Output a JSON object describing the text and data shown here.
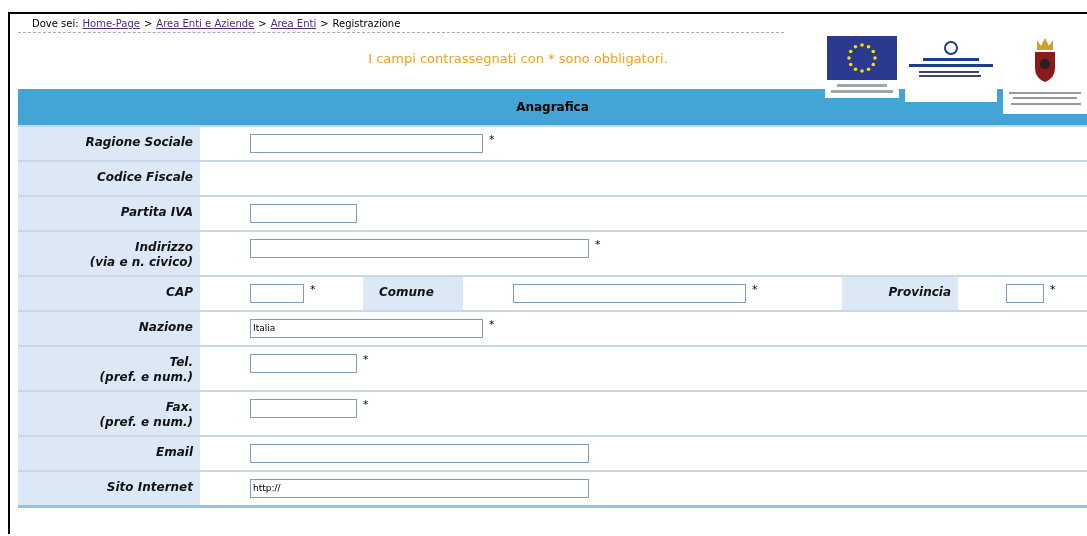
{
  "breadcrumb": {
    "label": "Dove sei:",
    "links": [
      "Home-Page",
      "Area Enti e Aziende",
      "Area Enti"
    ],
    "current": "Registrazione",
    "separator": ">"
  },
  "notice": "I campi contrassegnati con * sono obbligatori.",
  "section_title": "Anagrafica",
  "rows": [
    {
      "kind": "single",
      "label": "Ragione Sociale",
      "field": {
        "mark": "*"
      }
    },
    {
      "kind": "single",
      "label": "Codice Fiscale"
    },
    {
      "kind": "single",
      "label": "Partita IVA",
      "field": {}
    },
    {
      "kind": "single",
      "label": "Indirizzo",
      "sublabel": "(via e n. civico)",
      "field": {
        "mark": "*"
      }
    },
    {
      "kind": "triple",
      "cells": [
        {
          "label": "CAP",
          "field": {
            "mark": "*"
          }
        },
        {
          "label": "Comune",
          "field": {
            "mark": "*"
          }
        },
        {
          "label": "Provincia",
          "field": {
            "mark": "*"
          }
        }
      ]
    },
    {
      "kind": "single",
      "label": "Nazione",
      "field": {
        "value": "Italia",
        "mark": "*"
      }
    },
    {
      "kind": "single",
      "label": "Tel.",
      "sublabel": "(pref. e num.)",
      "field": {
        "mark": "*"
      }
    },
    {
      "kind": "single",
      "label": "Fax.",
      "sublabel": "(pref. e num.)",
      "field": {
        "mark": "*"
      }
    },
    {
      "kind": "single",
      "label": "Email",
      "field": {}
    },
    {
      "kind": "single",
      "label": "Sito Internet",
      "field": {
        "value": "http://"
      }
    }
  ]
}
